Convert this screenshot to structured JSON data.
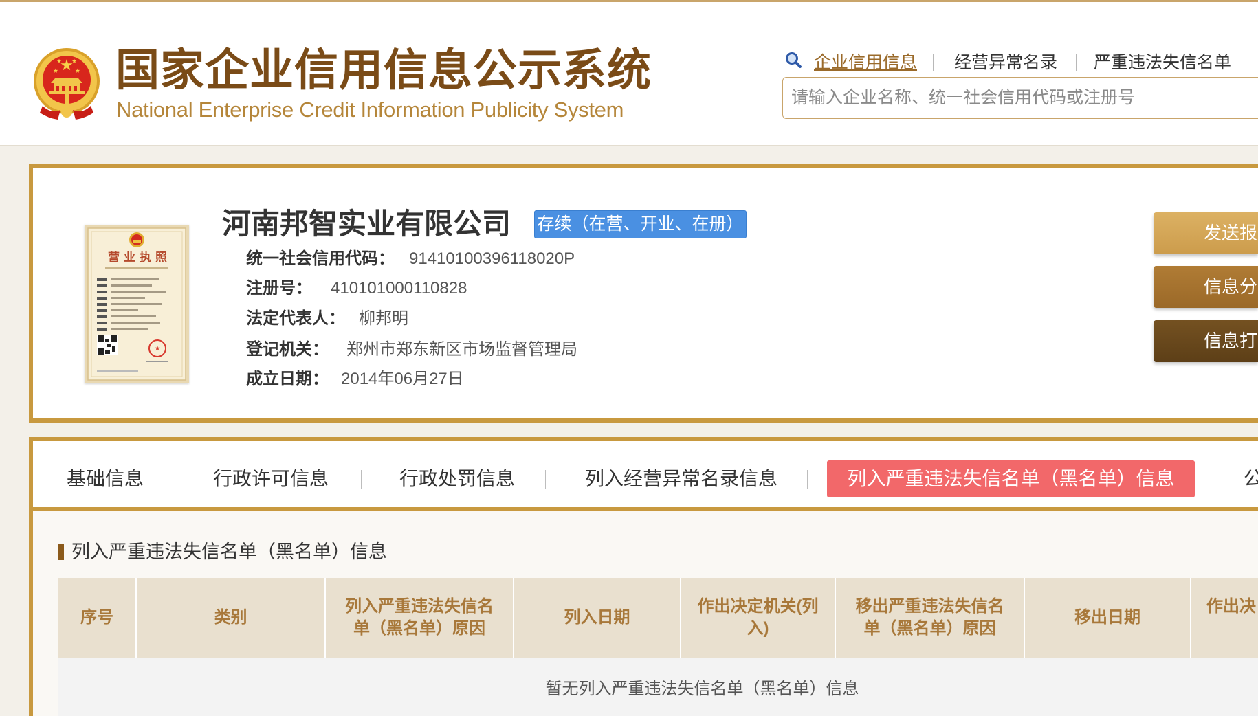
{
  "colors": {
    "brand_gold": "#c8993f",
    "title_brown": "#7a4b17",
    "subtitle_gold": "#b5863a",
    "status_badge_blue": "#4a90e2",
    "active_tab_red": "#f2686a",
    "section_marker": "#8b5a1b",
    "send_button": "#d4a85a",
    "share_button": "#a5722e",
    "print_button": "#694a1f",
    "table_header_bg": "#e9e0cf",
    "table_header_text": "#a8783a"
  },
  "header": {
    "emblem_icon": "national-emblem-icon",
    "title": "国家企业信用信息公示系统",
    "subtitle": "National Enterprise Credit Information Publicity System",
    "search_icon": "search-icon",
    "nav": [
      {
        "label": "企业信用信息",
        "active": true
      },
      {
        "label": "经营异常名录",
        "active": false
      },
      {
        "label": "严重违法失信名单",
        "active": false
      }
    ],
    "search": {
      "placeholder": "请输入企业名称、统一社会信用代码或注册号",
      "value": ""
    }
  },
  "company": {
    "license_thumbnail": {
      "icon": "business-license-image",
      "title": "营业执照"
    },
    "name": "河南邦智实业有限公司",
    "status": "存续（在营、开业、在册）",
    "fields": [
      {
        "label": "统一社会信用代码：",
        "value": "91410100396118020P"
      },
      {
        "label": "注册号：",
        "value": "410101000110828"
      },
      {
        "label": "法定代表人：",
        "value": "柳邦明"
      },
      {
        "label": "登记机关：",
        "value": "郑州市郑东新区市场监督管理局"
      },
      {
        "label": "成立日期：",
        "value": "2014年06月27日"
      }
    ],
    "actions": [
      {
        "label": "发送报告"
      },
      {
        "label": "信息分享"
      },
      {
        "label": "信息打印"
      }
    ]
  },
  "tabs": {
    "active_index": 4,
    "items": [
      {
        "label": "基础信息"
      },
      {
        "label": "行政许可信息"
      },
      {
        "label": "行政处罚信息"
      },
      {
        "label": "列入经营异常名录信息"
      },
      {
        "label": "列入严重违法失信名单（黑名单）信息"
      },
      {
        "label": "公"
      }
    ]
  },
  "section": {
    "title": "列入严重违法失信名单（黑名单）信息",
    "table": {
      "columns": [
        "序号",
        "类别",
        "列入严重违法失信名单（黑名单）原因",
        "列入日期",
        "作出决定机关(列入)",
        "移出严重违法失信名单（黑名单）原因",
        "移出日期",
        "作出决"
      ],
      "rows": [],
      "empty_text": "暂无列入严重违法失信名单（黑名单）信息"
    }
  }
}
